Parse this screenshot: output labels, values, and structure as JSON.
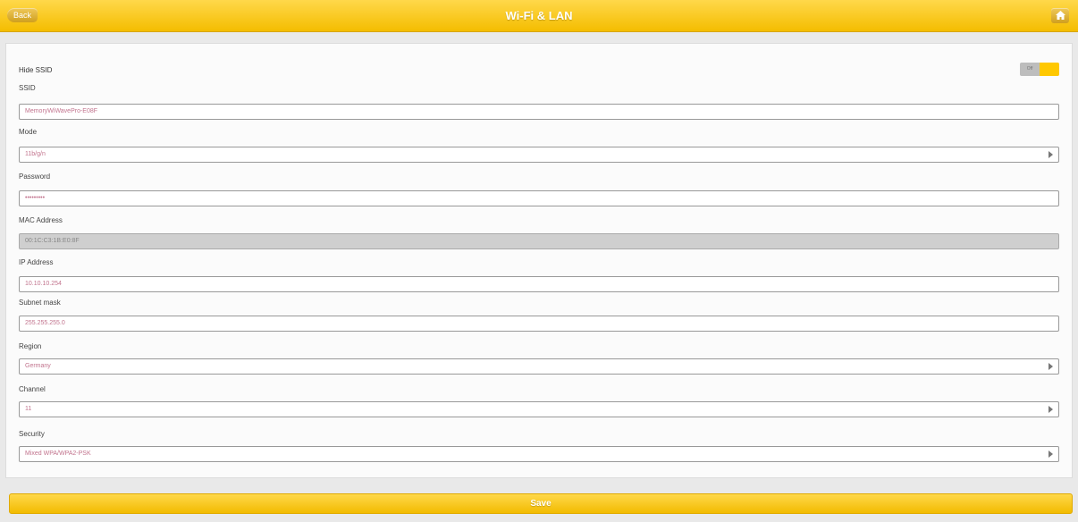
{
  "header": {
    "back_label": "Back",
    "title": "Wi-Fi & LAN"
  },
  "form": {
    "hide_ssid": {
      "label": "Hide SSID",
      "toggle_off": "Off",
      "enabled": true
    },
    "fields": [
      {
        "label": "SSID",
        "value": "MemoryWiWavePro-E08F",
        "dropdown": false,
        "disabled": false
      },
      {
        "label": "Mode",
        "value": "11b/g/n",
        "dropdown": true,
        "disabled": false
      },
      {
        "label": "Password",
        "value": "•••••••••",
        "dropdown": false,
        "disabled": false
      },
      {
        "label": "MAC Address",
        "value": "00:1C:C3:1B:E0:8F",
        "dropdown": false,
        "disabled": true
      },
      {
        "label": "IP Address",
        "value": "10.10.10.254",
        "dropdown": false,
        "disabled": false
      },
      {
        "label": "Subnet mask",
        "value": "255.255.255.0",
        "dropdown": false,
        "disabled": false
      },
      {
        "label": "Region",
        "value": "Germany",
        "dropdown": true,
        "disabled": false
      },
      {
        "label": "Channel",
        "value": "11",
        "dropdown": true,
        "disabled": false
      },
      {
        "label": "Security",
        "value": "Mixed WPA/WPA2-PSK",
        "dropdown": true,
        "disabled": false
      }
    ]
  },
  "save_label": "Save",
  "colors": {
    "accent": "#f4bd00",
    "value_text": "#c2748e",
    "disabled_field": "#cfcfcf"
  }
}
